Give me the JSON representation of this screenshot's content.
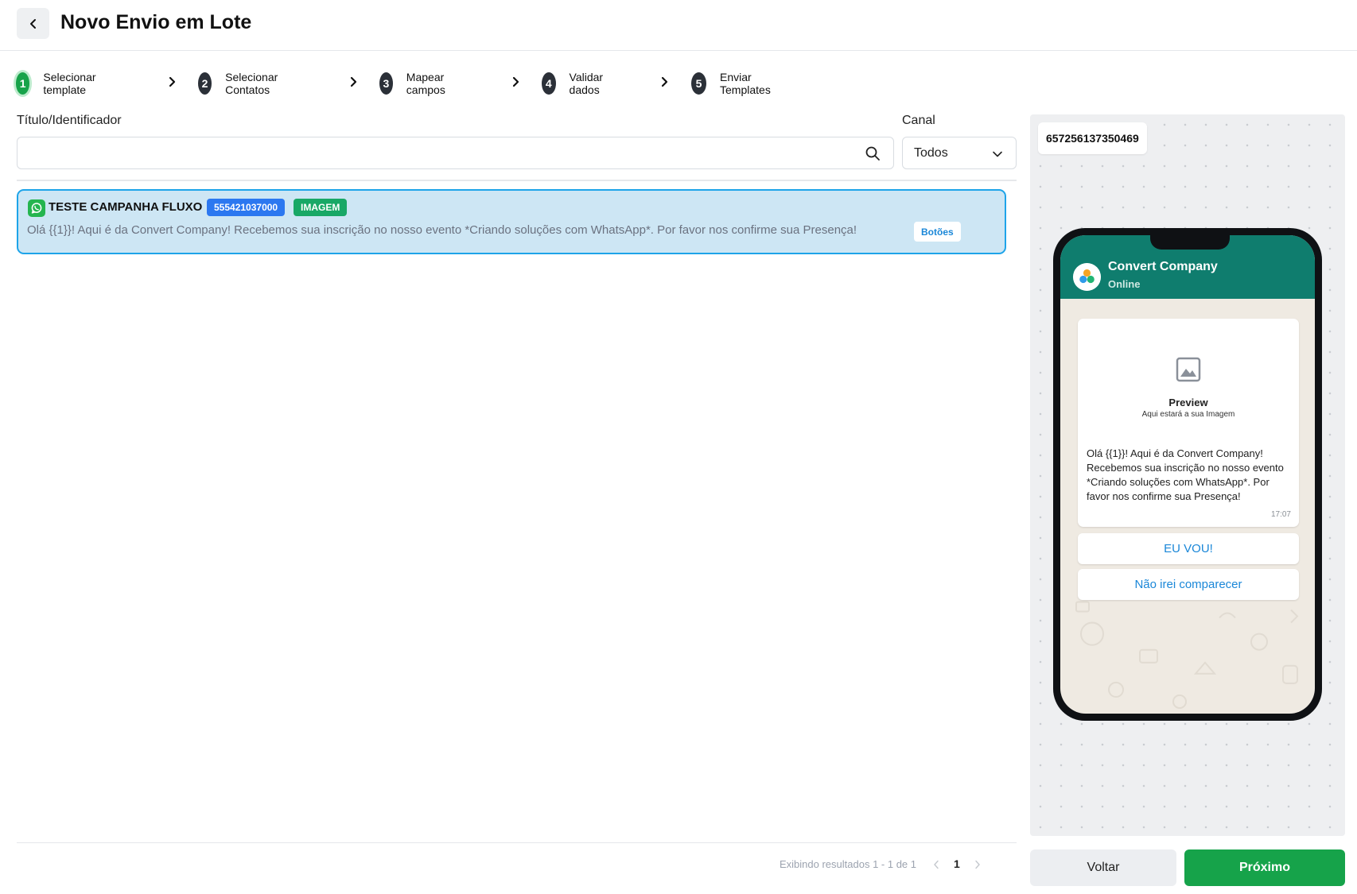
{
  "header": {
    "title": "Novo Envio em Lote"
  },
  "stepper": {
    "steps": [
      {
        "number": "1",
        "label": "Selecionar template"
      },
      {
        "number": "2",
        "label": "Selecionar Contatos"
      },
      {
        "number": "3",
        "label": "Mapear campos"
      },
      {
        "number": "4",
        "label": "Validar dados"
      },
      {
        "number": "5",
        "label": "Enviar Templates"
      }
    ],
    "active_step": "1"
  },
  "filters": {
    "title_label": "Título/Identificador",
    "search_value": "",
    "channel_label": "Canal",
    "channel_value": "Todos"
  },
  "templates": [
    {
      "name": "TESTE CAMPANHA FLUXO",
      "phone": "555421037000",
      "type": "IMAGEM",
      "text": "Olá {{1}}! Aqui é da Convert Company! Recebemos sua inscrição no nosso evento *Criando soluções com WhatsApp*. Por favor nos confirme sua Presença!",
      "tag": "Botões"
    }
  ],
  "pagination": {
    "summary": "Exibindo resultados 1 - 1 de 1",
    "current_page": "1"
  },
  "preview": {
    "phone_id": "657256137350469",
    "contact_name": "Convert Company",
    "contact_status": "Online",
    "media_title": "Preview",
    "media_subtitle": "Aqui estará a sua Imagem",
    "message": "Olá {{1}}! Aqui é da Convert Company! Recebemos sua inscrição no nosso evento *Criando soluções com WhatsApp*. Por favor nos confirme sua Presença!",
    "time": "17:07",
    "buttons": [
      "EU VOU!",
      "Não irei comparecer"
    ]
  },
  "actions": {
    "back_label": "Voltar",
    "next_label": "Próximo"
  },
  "colors": {
    "primary_green": "#16a34a",
    "selected_border": "#1ea4e9",
    "selected_bg": "#cde6f4",
    "whatsapp_header": "#0f7d6e",
    "phone_badge": "#2c78f0",
    "type_badge": "#19a866"
  },
  "icons": [
    "chevron-left-icon",
    "chevron-right-icon",
    "search-icon",
    "chevron-down-icon",
    "whatsapp-icon",
    "image-icon",
    "company-logo-icon"
  ]
}
